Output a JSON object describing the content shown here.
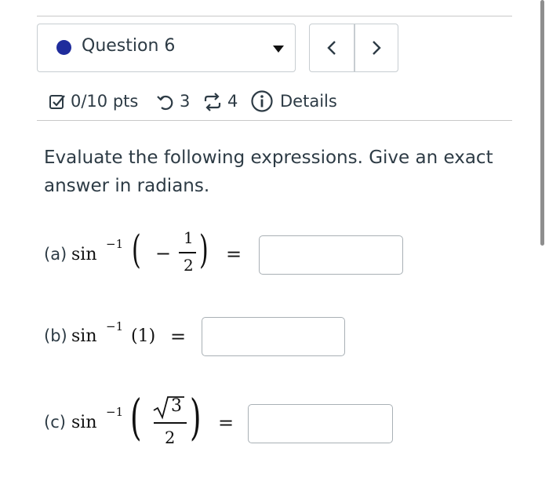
{
  "question_nav": {
    "selected_question": "Question 6",
    "prev_label": "‹",
    "next_label": "›",
    "dot_color": "#1f2c9c"
  },
  "meta": {
    "points": "0/10 pts",
    "retries": "3",
    "submissions": "4",
    "details": "Details",
    "points_icon": "checkbox-icon",
    "retries_icon": "undo-icon",
    "submissions_icon": "repeat-icon",
    "details_icon": "info-icon"
  },
  "prompt": "Evaluate the following expressions. Give an exact answer in radians.",
  "parts": [
    {
      "label": "(a)",
      "func": "sin",
      "exp": "−1",
      "minus": "−",
      "num": "1",
      "den": "2",
      "equals": "="
    },
    {
      "label": "(b)",
      "func": "sin",
      "exp": "−1",
      "arg": "(1)",
      "equals": "="
    },
    {
      "label": "(c)",
      "func": "sin",
      "exp": "−1",
      "num_radicand": "3",
      "den": "2",
      "equals": "="
    }
  ]
}
